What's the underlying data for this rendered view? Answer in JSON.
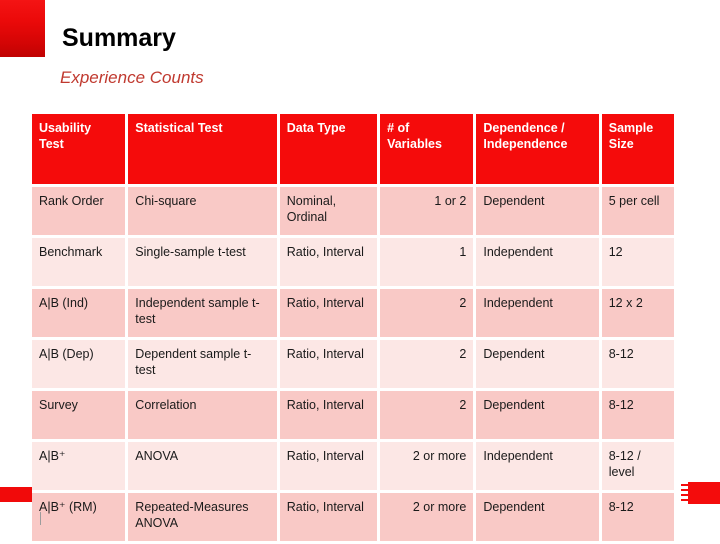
{
  "slide": {
    "title": "Summary",
    "subtitle": "Experience Counts",
    "footer_note": "",
    "accent_color": "#f50b0b",
    "subtitle_color": "#c0392f",
    "header_row_color": "#f50b0b",
    "row_odd_color": "#f9c9c6",
    "row_even_color": "#fce7e5"
  },
  "table": {
    "headers": [
      "Usability Test",
      "Statistical Test",
      "Data Type",
      "# of Variables",
      "Dependence / Independence",
      "Sample Size"
    ],
    "rows": [
      {
        "usability_test": "Rank Order",
        "statistical_test": "Chi-square",
        "data_type": "Nominal, Ordinal",
        "num_variables": "1 or 2",
        "dependence": "Dependent",
        "sample_size": "5 per cell"
      },
      {
        "usability_test": "Benchmark",
        "statistical_test": "Single-sample t-test",
        "data_type": "Ratio, Interval",
        "num_variables": "1",
        "dependence": "Independent",
        "sample_size": "12"
      },
      {
        "usability_test": "A|B (Ind)",
        "statistical_test": "Independent sample t-test",
        "data_type": "Ratio, Interval",
        "num_variables": "2",
        "dependence": "Independent",
        "sample_size": "12 x 2"
      },
      {
        "usability_test": "A|B (Dep)",
        "statistical_test": "Dependent sample t-test",
        "data_type": "Ratio, Interval",
        "num_variables": "2",
        "dependence": "Dependent",
        "sample_size": "8-12"
      },
      {
        "usability_test": "Survey",
        "statistical_test": "Correlation",
        "data_type": "Ratio, Interval",
        "num_variables": "2",
        "dependence": "Dependent",
        "sample_size": "8-12"
      },
      {
        "usability_test": "A|B⁺",
        "statistical_test": "ANOVA",
        "data_type": "Ratio, Interval",
        "num_variables": "2 or more",
        "dependence": "Independent",
        "sample_size": "8-12 / level"
      },
      {
        "usability_test": "A|B⁺ (RM)",
        "statistical_test": "Repeated-Measures ANOVA",
        "data_type": "Ratio, Interval",
        "num_variables": "2 or more",
        "dependence": "Dependent",
        "sample_size": "8-12"
      }
    ]
  }
}
